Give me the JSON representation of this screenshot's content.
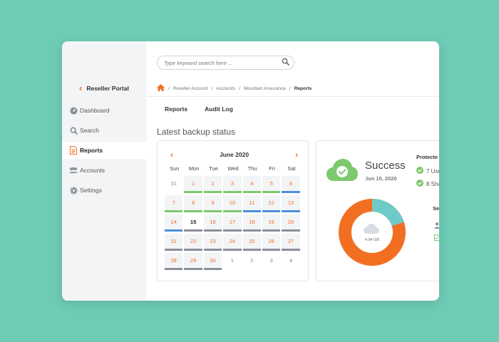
{
  "sidebar": {
    "portal_label": "Reseller Portal",
    "items": [
      {
        "label": "Dashboard",
        "icon": "dashboard-icon"
      },
      {
        "label": "Search",
        "icon": "search-icon"
      },
      {
        "label": "Reports",
        "icon": "report-icon",
        "active": true
      },
      {
        "label": "Accounts",
        "icon": "accounts-icon"
      },
      {
        "label": "Settings",
        "icon": "gear-icon"
      }
    ]
  },
  "search": {
    "placeholder": "Type keyword search here ..."
  },
  "breadcrumb": {
    "items": [
      "Reseller Account",
      "Accounts",
      "Mountain Assurance"
    ],
    "current": "Reports"
  },
  "tabs": [
    "Reports",
    "Audit Log"
  ],
  "section_title": "Latest backup status",
  "calendar": {
    "month": "June 2020",
    "weekdays": [
      "Sun",
      "Mon",
      "Tue",
      "Wed",
      "Thu",
      "Fri",
      "Sat"
    ],
    "days": [
      {
        "d": "31",
        "s": "none"
      },
      {
        "d": "1",
        "s": "green"
      },
      {
        "d": "2",
        "s": "green"
      },
      {
        "d": "3",
        "s": "green"
      },
      {
        "d": "4",
        "s": "green"
      },
      {
        "d": "5",
        "s": "green"
      },
      {
        "d": "6",
        "s": "blue"
      },
      {
        "d": "7",
        "s": "green"
      },
      {
        "d": "8",
        "s": "green"
      },
      {
        "d": "9",
        "s": "green"
      },
      {
        "d": "10",
        "s": "green"
      },
      {
        "d": "11",
        "s": "blue"
      },
      {
        "d": "12",
        "s": "blue"
      },
      {
        "d": "13",
        "s": "blue"
      },
      {
        "d": "14",
        "s": "blue"
      },
      {
        "d": "15",
        "s": "today"
      },
      {
        "d": "16",
        "s": "gray"
      },
      {
        "d": "17",
        "s": "gray"
      },
      {
        "d": "18",
        "s": "gray"
      },
      {
        "d": "19",
        "s": "gray"
      },
      {
        "d": "20",
        "s": "gray"
      },
      {
        "d": "21",
        "s": "gray"
      },
      {
        "d": "22",
        "s": "gray"
      },
      {
        "d": "23",
        "s": "gray"
      },
      {
        "d": "24",
        "s": "gray"
      },
      {
        "d": "25",
        "s": "gray"
      },
      {
        "d": "26",
        "s": "gray"
      },
      {
        "d": "27",
        "s": "gray"
      },
      {
        "d": "28",
        "s": "gray"
      },
      {
        "d": "29",
        "s": "gray"
      },
      {
        "d": "30",
        "s": "gray"
      },
      {
        "d": "1",
        "s": "none"
      },
      {
        "d": "2",
        "s": "none"
      },
      {
        "d": "3",
        "s": "none"
      },
      {
        "d": "4",
        "s": "none"
      }
    ]
  },
  "summary": {
    "status": "Success",
    "date": "Jun 15, 2020",
    "protected_title": "Protecte",
    "protected_items": [
      "7 Use",
      "8 Sha"
    ],
    "donut_center": "4.94 GB",
    "donut_fraction_teal": 0.2,
    "section2_title": "Se"
  },
  "colors": {
    "accent": "#f26f21",
    "success": "#7ec86e",
    "teal": "#6ecbc8",
    "blue": "#4a8fe0",
    "gray_bar": "#8a8f98"
  }
}
